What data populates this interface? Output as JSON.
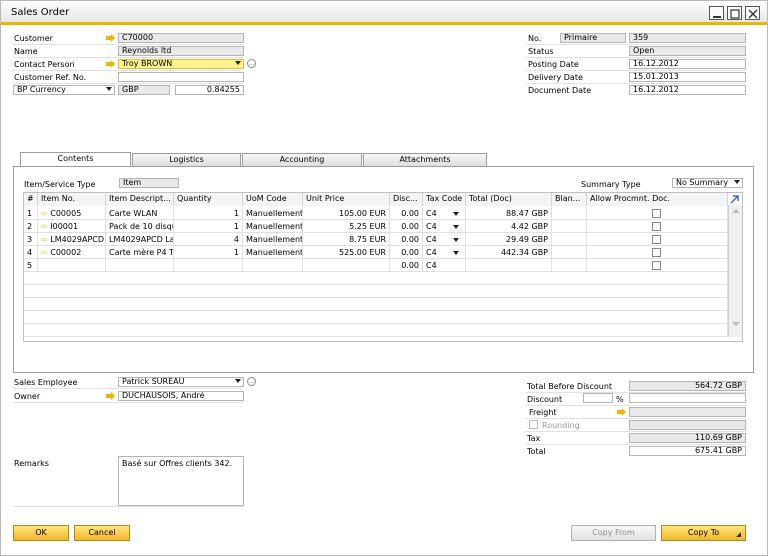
{
  "window": {
    "title": "Sales Order"
  },
  "header_left": {
    "customer_label": "Customer",
    "customer_value": "C70000",
    "name_label": "Name",
    "name_value": "Reynolds ltd",
    "contact_label": "Contact Person",
    "contact_value": "Troy BROWN",
    "ref_label": "Customer Ref. No.",
    "ref_value": "",
    "currency_label": "BP Currency",
    "currency_code": "GBP",
    "currency_rate": "0.84255"
  },
  "header_right": {
    "no_label": "No.",
    "series": "Primaire",
    "no_value": "359",
    "status_label": "Status",
    "status_value": "Open",
    "posting_label": "Posting Date",
    "posting_value": "16.12.2012",
    "delivery_label": "Delivery Date",
    "delivery_value": "15.01.2013",
    "document_label": "Document Date",
    "document_value": "16.12.2012"
  },
  "tabs": [
    {
      "label": "Contents"
    },
    {
      "label": "Logistics"
    },
    {
      "label": "Accounting"
    },
    {
      "label": "Attachments"
    }
  ],
  "contents": {
    "item_type_label": "Item/Service Type",
    "item_type_value": "Item",
    "summary_label": "Summary Type",
    "summary_value": "No Summary",
    "columns": [
      "#",
      "Item No.",
      "Item Descript...",
      "Quantity",
      "UoM Code",
      "Unit Price",
      "Disc...",
      "Tax Code",
      "Total (Doc)",
      "Blan...",
      "Allow Procmnt. Doc."
    ],
    "rows": [
      {
        "n": "1",
        "item": "C00005",
        "desc": "Carte WLAN",
        "qty": "1",
        "uom": "Manuellement",
        "price": "105.00 EUR",
        "disc": "0.00",
        "tax": "C4",
        "total": "88.47 GBP"
      },
      {
        "n": "2",
        "item": "I00001",
        "desc": "Pack de 10 disqu",
        "qty": "1",
        "uom": "Manuellement",
        "price": "5.25 EUR",
        "disc": "0.00",
        "tax": "C4",
        "total": "4.42 GBP"
      },
      {
        "n": "3",
        "item": "LM4029APCD",
        "desc": "LM4029APCD Las",
        "qty": "4",
        "uom": "Manuellement",
        "price": "8.75 EUR",
        "disc": "0.00",
        "tax": "C4",
        "total": "29.49 GBP"
      },
      {
        "n": "4",
        "item": "C00002",
        "desc": "Carte mère P4 Tu",
        "qty": "1",
        "uom": "Manuellement",
        "price": "525.00 EUR",
        "disc": "0.00",
        "tax": "C4",
        "total": "442.34 GBP"
      },
      {
        "n": "5",
        "item": "",
        "desc": "",
        "qty": "",
        "uom": "",
        "price": "",
        "disc": "0.00",
        "tax": "C4",
        "total": ""
      }
    ]
  },
  "footer_left": {
    "employee_label": "Sales Employee",
    "employee_value": "Patrick SUREAU",
    "owner_label": "Owner",
    "owner_value": "DUCHAUSOIS, André",
    "remarks_label": "Remarks",
    "remarks_value": "Basé sur Offres clients 342."
  },
  "footer_right": {
    "tbd_label": "Total Before Discount",
    "tbd_value": "564.72 GBP",
    "discount_label": "Discount",
    "discount_pct": "%",
    "freight_label": "Freight",
    "rounding_label": "Rounding",
    "tax_label": "Tax",
    "tax_value": "110.69 GBP",
    "total_label": "Total",
    "total_value": "675.41 GBP"
  },
  "buttons": {
    "ok": "OK",
    "cancel": "Cancel",
    "copy_from": "Copy From",
    "copy_to": "Copy To"
  },
  "colors": {
    "accent": "#f0b400",
    "yellow_field": "#fff28a",
    "readonly": "#e9e9e9"
  }
}
